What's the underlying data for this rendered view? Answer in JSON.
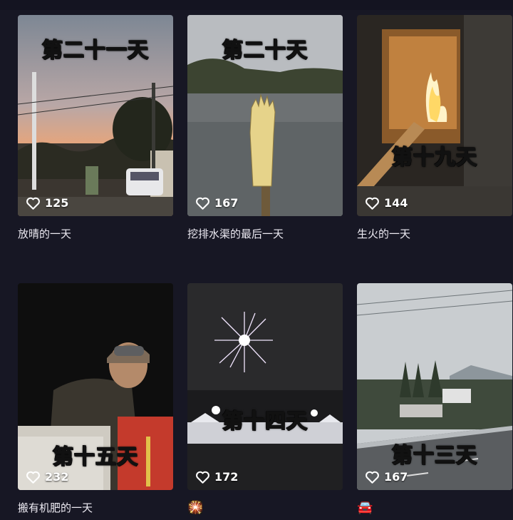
{
  "videos": [
    {
      "overlay": "第二十一天",
      "likes": "125",
      "caption": "放晴的一天"
    },
    {
      "overlay": "第二十天",
      "likes": "167",
      "caption": "挖排水渠的最后一天"
    },
    {
      "overlay": "第十九天",
      "likes": "144",
      "caption": "生火的一天"
    },
    {
      "overlay": "第十五天",
      "likes": "232",
      "caption": "搬有机肥的一天"
    },
    {
      "overlay": "第十四天",
      "likes": "172",
      "caption": "🎇"
    },
    {
      "overlay": "第十三天",
      "likes": "167",
      "caption": "🚘"
    }
  ],
  "icons": {
    "like": "heart-outline-icon"
  },
  "colors": {
    "background": "#171724",
    "text": "#eceaf2",
    "like_text": "#ffffff"
  }
}
